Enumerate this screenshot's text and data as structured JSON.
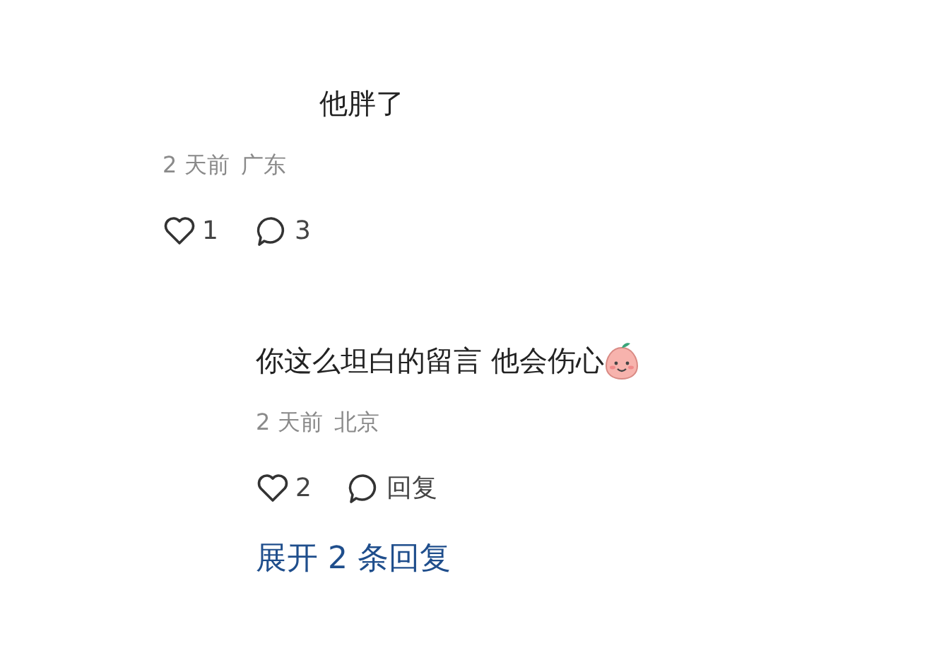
{
  "comments": [
    {
      "kind": "top",
      "text": "他胖了",
      "sticker": false,
      "time": "2 天前",
      "location": "广东",
      "likes": "1",
      "reply": "3"
    },
    {
      "kind": "reply",
      "text": "你这么坦白的留言 他会伤心",
      "sticker": true,
      "time": "2 天前",
      "location": "北京",
      "likes": "2",
      "reply": "回复"
    }
  ],
  "expand": {
    "label": "展开 2 条回复"
  }
}
